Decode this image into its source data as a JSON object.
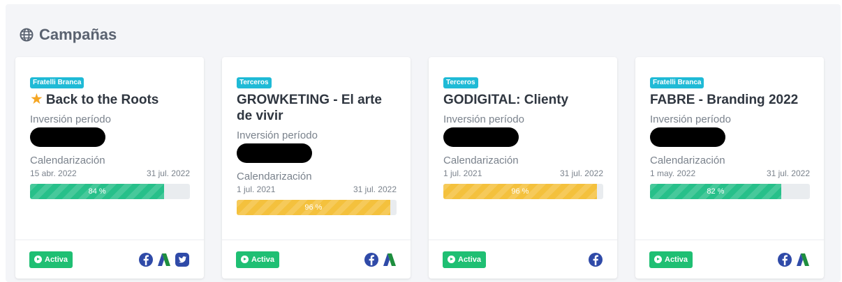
{
  "header": {
    "title": "Campañas",
    "icon": "globe-icon"
  },
  "labels": {
    "investment": "Inversión período",
    "schedule": "Calendarización"
  },
  "status_label": "Activa",
  "colors": {
    "badge": "#1fbad6",
    "active": "#1fbf73",
    "progress_green": "#27c08a",
    "progress_yellow": "#f4c13d",
    "star": "#f5a623"
  },
  "campaigns": [
    {
      "badge": "Fratelli Branca",
      "starred": true,
      "title": "Back to the Roots",
      "start": "15 abr. 2022",
      "end": "31 jul. 2022",
      "progress": 84,
      "progress_label": "84 %",
      "progress_color": "green",
      "platforms": [
        "facebook-icon",
        "google-ads-icon",
        "twitter-icon"
      ]
    },
    {
      "badge": "Terceros",
      "starred": false,
      "title": "GROWKETING - El arte de vivir",
      "start": "1 jul. 2021",
      "end": "31 jul. 2022",
      "progress": 96,
      "progress_label": "96 %",
      "progress_color": "yellow",
      "platforms": [
        "facebook-icon",
        "google-ads-icon"
      ]
    },
    {
      "badge": "Terceros",
      "starred": false,
      "title": "GODIGITAL: Clienty",
      "start": "1 jul. 2021",
      "end": "31 jul. 2022",
      "progress": 96,
      "progress_label": "96 %",
      "progress_color": "yellow",
      "platforms": [
        "facebook-icon"
      ]
    },
    {
      "badge": "Fratelli Branca",
      "starred": false,
      "title": "FABRE - Branding 2022",
      "start": "1 may. 2022",
      "end": "31 jul. 2022",
      "progress": 82,
      "progress_label": "82 %",
      "progress_color": "green",
      "platforms": [
        "facebook-icon",
        "google-ads-icon"
      ]
    }
  ]
}
